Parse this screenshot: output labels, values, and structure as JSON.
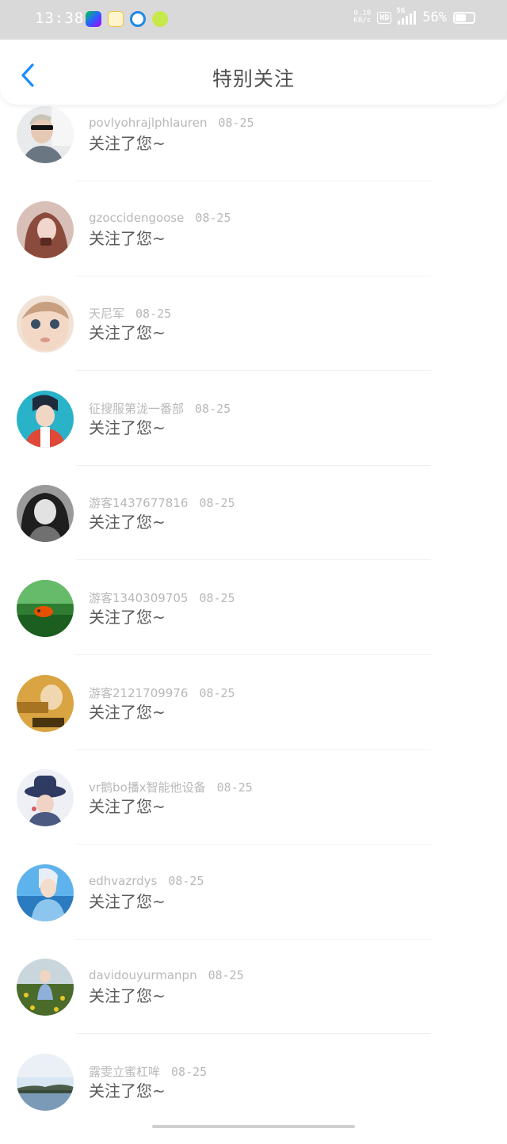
{
  "status": {
    "time": "13:38",
    "net_speed_value": "0.10",
    "net_speed_unit": "KB/s",
    "hd": "HD",
    "network": "5G",
    "battery": "56%"
  },
  "header": {
    "title": "特别关注"
  },
  "items": [
    {
      "name": "povlyohrajlphlauren",
      "date": "08-25",
      "action": "关注了您~"
    },
    {
      "name": "gzoccidengoose",
      "date": "08-25",
      "action": "关注了您~"
    },
    {
      "name": "天尼军",
      "date": "08-25",
      "action": "关注了您~"
    },
    {
      "name": "征搜服第泷一番部",
      "date": "08-25",
      "action": "关注了您~"
    },
    {
      "name": "游客1437677816",
      "date": "08-25",
      "action": "关注了您~"
    },
    {
      "name": "游客1340309705",
      "date": "08-25",
      "action": "关注了您~"
    },
    {
      "name": "游客2121709976",
      "date": "08-25",
      "action": "关注了您~"
    },
    {
      "name": "vr鹅bo播x智能他设备",
      "date": "08-25",
      "action": "关注了您~"
    },
    {
      "name": "edhvazrdys",
      "date": "08-25",
      "action": "关注了您~"
    },
    {
      "name": "davidouyurmanpn",
      "date": "08-25",
      "action": "关注了您~"
    },
    {
      "name": "露雯立蜜杠哞",
      "date": "08-25",
      "action": "关注了您~"
    }
  ],
  "colors": {
    "accent": "#1a8cff",
    "statusbar": "#d9d9d9"
  }
}
